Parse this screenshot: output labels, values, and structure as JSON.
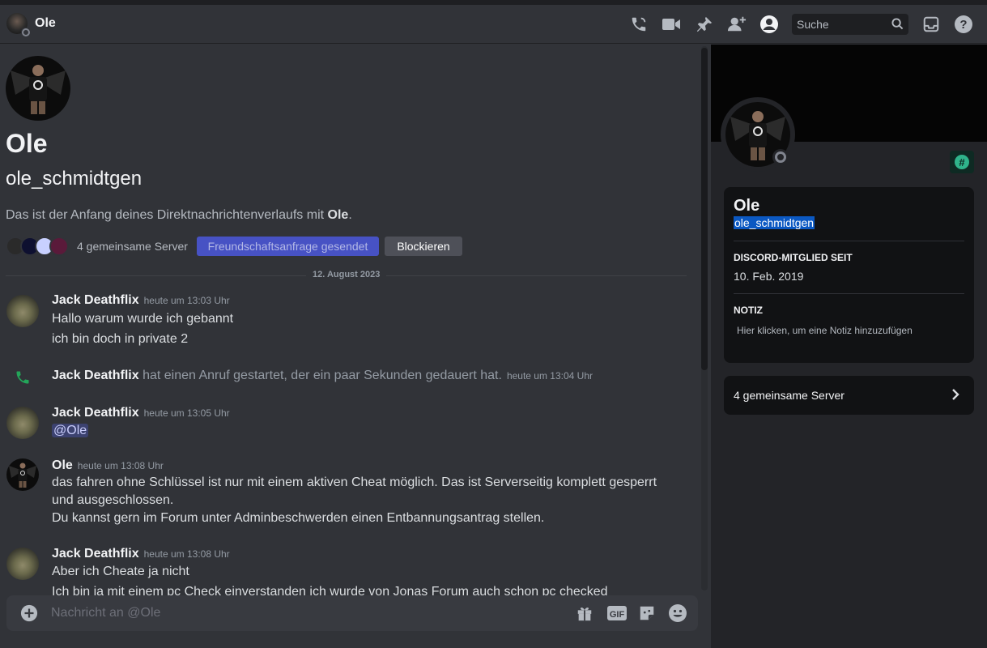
{
  "header": {
    "channel_name": "Ole",
    "search_placeholder": "Suche"
  },
  "intro": {
    "display_name": "Ole",
    "username": "ole_schmidtgen",
    "text_prefix": "Das ist der Anfang deines Direktnachrichtenverlaufs mit ",
    "text_name": "Ole",
    "text_suffix": ".",
    "mutual_servers": "4 gemeinsame Server",
    "friend_request_button": "Freundschaftsanfrage gesendet",
    "block_button": "Blockieren"
  },
  "date_divider": "12. August 2023",
  "messages": [
    {
      "author": "Jack Deathflix",
      "timestamp": "heute um 13:03 Uhr",
      "lines": [
        "Hallo warum wurde ich gebannt",
        "ich bin doch in private 2"
      ]
    },
    {
      "author": "Jack Deathflix",
      "call_text": "hat einen Anruf gestartet, der ein paar Sekunden gedauert hat.",
      "timestamp": "heute um 13:04 Uhr"
    },
    {
      "author": "Jack Deathflix",
      "timestamp": "heute um 13:05 Uhr",
      "mention": "@Ole"
    },
    {
      "author": "Ole",
      "timestamp": "heute um 13:08 Uhr",
      "lines": [
        "das fahren ohne Schlüssel ist nur mit einem aktiven Cheat möglich. Das ist Serverseitig komplett gesperrt und ausgeschlossen.",
        "Du kannst gern im Forum unter Adminbeschwerden einen Entbannungsantrag stellen."
      ]
    },
    {
      "author": "Jack Deathflix",
      "timestamp": "heute um 13:08 Uhr",
      "lines": [
        "Aber ich Cheate ja nicht",
        "Ich bin ja mit einem pc Check einverstanden ich wurde von Jonas Forum auch schon pc checked"
      ]
    }
  ],
  "composer": {
    "placeholder": "Nachricht an @Ole",
    "gif_label": "GIF"
  },
  "profile": {
    "display_name": "Ole",
    "username": "ole_schmidtgen",
    "member_since_label": "DISCORD-MITGLIED SEIT",
    "member_since": "10. Feb. 2019",
    "note_label": "NOTIZ",
    "note_placeholder": "Hier klicken, um eine Notiz hinzuzufügen",
    "mutual_servers": "4 gemeinsame Server",
    "badge_symbol": "#"
  },
  "icons": [
    "voice-call-icon",
    "video-call-icon",
    "pin-icon",
    "add-member-icon",
    "user-profile-icon",
    "search-icon",
    "inbox-icon",
    "help-icon",
    "call-icon",
    "add-attachment-icon",
    "gift-icon",
    "gif-icon",
    "sticker-icon",
    "emoji-icon",
    "chevron-right-icon"
  ],
  "colors": {
    "background": "#313338",
    "profile_background": "#232428",
    "card_background": "#111214",
    "friend_button": "#4752c4",
    "block_button": "#4e5058",
    "call_icon": "#23a559",
    "mention_bg": "#3c4270",
    "selection": "#0b58c2"
  }
}
